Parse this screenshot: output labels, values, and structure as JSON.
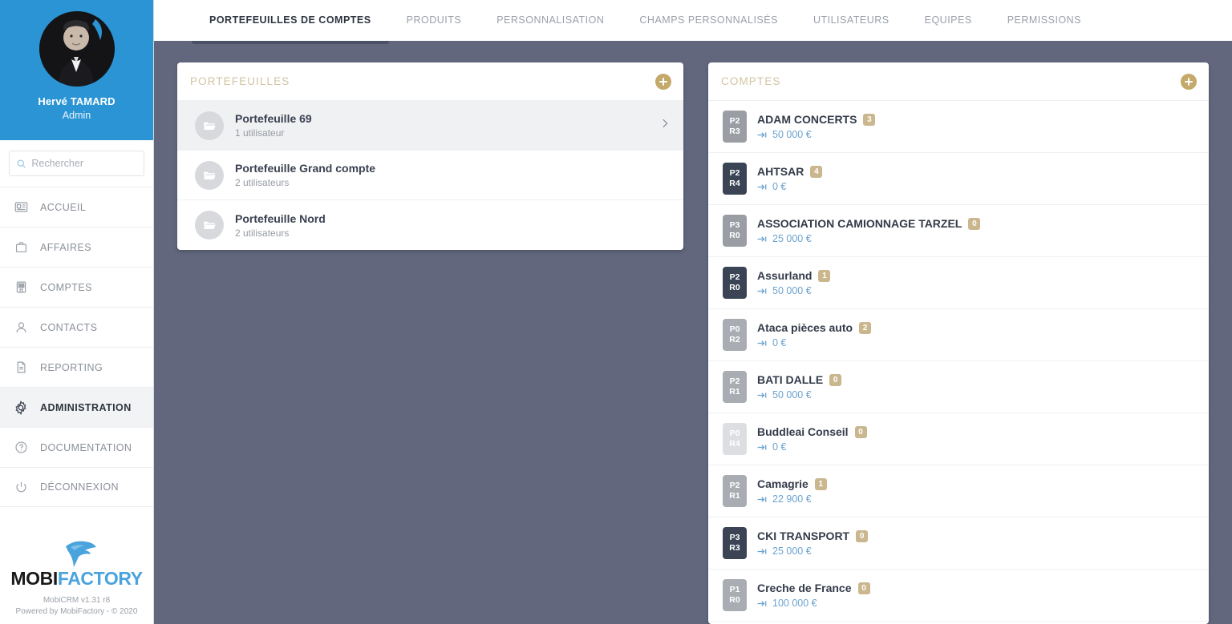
{
  "sidebar": {
    "profile": {
      "name": "Hervé TAMARD",
      "role": "Admin",
      "avatar_icon": "user-photo"
    },
    "search": {
      "placeholder": "Rechercher",
      "value": "",
      "icon": "search-icon"
    },
    "items": [
      {
        "label": "ACCUEIL",
        "icon": "home-card-icon",
        "active": false
      },
      {
        "label": "AFFAIRES",
        "icon": "briefcase-icon",
        "active": false
      },
      {
        "label": "COMPTES",
        "icon": "building-icon",
        "active": false
      },
      {
        "label": "CONTACTS",
        "icon": "person-icon",
        "active": false
      },
      {
        "label": "REPORTING",
        "icon": "document-icon",
        "active": false
      },
      {
        "label": "ADMINISTRATION",
        "icon": "gear-icon",
        "active": true
      },
      {
        "label": "DOCUMENTATION",
        "icon": "question-circle-icon",
        "active": false
      },
      {
        "label": "DÉCONNEXION",
        "icon": "power-icon",
        "active": false
      }
    ],
    "brand": {
      "word_part1": "MOBI",
      "word_part2": "FACTORY",
      "version": "MobiCRM v1.31 r8",
      "copyright": "Powered by MobiFactory - © 2020",
      "bird_icon": "bird-logo-icon"
    }
  },
  "tabs": [
    {
      "label": "PORTEFEUILLES DE COMPTES",
      "active": true
    },
    {
      "label": "PRODUITS",
      "active": false
    },
    {
      "label": "PERSONNALISATION",
      "active": false
    },
    {
      "label": "CHAMPS PERSONNALISÉS",
      "active": false
    },
    {
      "label": "UTILISATEURS",
      "active": false
    },
    {
      "label": "EQUIPES",
      "active": false
    },
    {
      "label": "PERMISSIONS",
      "active": false
    }
  ],
  "portefeuilles_panel": {
    "title": "PORTEFEUILLES",
    "add_icon": "plus-circle-icon",
    "rows": [
      {
        "name": "Portefeuille 69",
        "sub": "1 utilisateur",
        "selected": true,
        "icon": "folder-icon",
        "chevron": "chevron-right-icon"
      },
      {
        "name": "Portefeuille Grand compte",
        "sub": "2 utilisateurs",
        "selected": false,
        "icon": "folder-icon"
      },
      {
        "name": "Portefeuille Nord",
        "sub": "2 utilisateurs",
        "selected": false,
        "icon": "folder-icon"
      }
    ]
  },
  "comptes_panel": {
    "title": "COMPTES",
    "add_icon": "plus-circle-icon",
    "rows": [
      {
        "p": "P2",
        "r": "R3",
        "badge_color": "#9a9ea4",
        "name": "ADAM CONCERTS",
        "count": "3",
        "amount": "50 000 €",
        "amount_icon": "arrow-to-bar-icon"
      },
      {
        "p": "P2",
        "r": "R4",
        "badge_color": "#3a4454",
        "name": "AHTSAR",
        "count": "4",
        "amount": "0 €",
        "amount_icon": "arrow-to-bar-icon"
      },
      {
        "p": "P3",
        "r": "R0",
        "badge_color": "#9a9ea4",
        "name": "ASSOCIATION CAMIONNAGE TARZEL",
        "count": "0",
        "amount": "25 000 €",
        "amount_icon": "arrow-to-bar-icon"
      },
      {
        "p": "P2",
        "r": "R0",
        "badge_color": "#3a4454",
        "name": "Assurland",
        "count": "1",
        "amount": "50 000 €",
        "amount_icon": "arrow-to-bar-icon"
      },
      {
        "p": "P0",
        "r": "R2",
        "badge_color": "#a9adb3",
        "name": "Ataca pièces auto",
        "count": "2",
        "amount": "0 €",
        "amount_icon": "arrow-to-bar-icon"
      },
      {
        "p": "P2",
        "r": "R1",
        "badge_color": "#a9adb3",
        "name": "BATI DALLE",
        "count": "0",
        "amount": "50 000 €",
        "amount_icon": "arrow-to-bar-icon"
      },
      {
        "p": "P0",
        "r": "R4",
        "badge_color": "#dcdee1",
        "name": "Buddleai Conseil",
        "count": "0",
        "amount": "0 €",
        "amount_icon": "arrow-to-bar-icon"
      },
      {
        "p": "P2",
        "r": "R1",
        "badge_color": "#a9adb3",
        "name": "Camagrie",
        "count": "1",
        "amount": "22 900 €",
        "amount_icon": "arrow-to-bar-icon"
      },
      {
        "p": "P3",
        "r": "R3",
        "badge_color": "#3a4454",
        "name": "CKI TRANSPORT",
        "count": "0",
        "amount": "25 000 €",
        "amount_icon": "arrow-to-bar-icon"
      },
      {
        "p": "P1",
        "r": "R0",
        "badge_color": "#a9adb3",
        "name": "Creche de France",
        "count": "0",
        "amount": "100 000 €",
        "amount_icon": "arrow-to-bar-icon"
      }
    ]
  },
  "colors": {
    "background": "#62677d",
    "profile_blue": "#2a94d4",
    "accent_gold": "#c4a96b",
    "panel_title": "#d3c3a2",
    "amount_blue": "#6ba3cf",
    "badge_tan": "#cbb78e"
  }
}
